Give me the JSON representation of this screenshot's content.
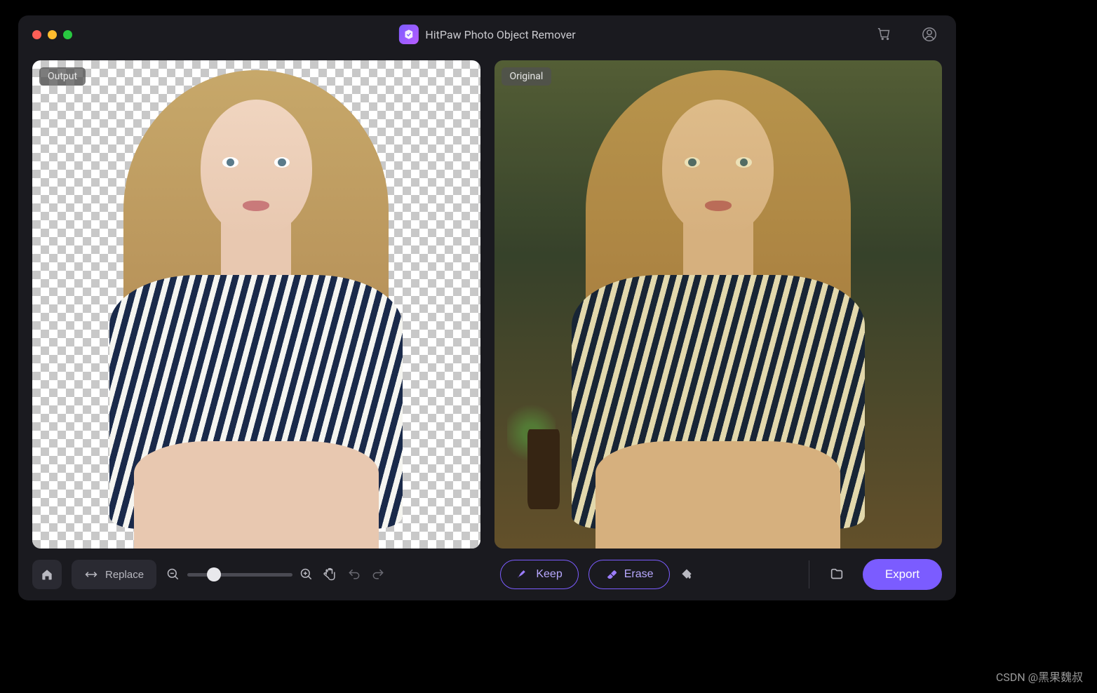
{
  "app": {
    "title": "HitPaw Photo Object Remover"
  },
  "panels": {
    "output_label": "Output",
    "original_label": "Original"
  },
  "toolbar": {
    "replace_label": "Replace",
    "keep_label": "Keep",
    "erase_label": "Erase",
    "export_label": "Export",
    "zoom_value": 25
  },
  "watermark": "CSDN @黑果魏叔",
  "colors": {
    "accent": "#7b5cff",
    "bg": "#1a1a1f"
  }
}
